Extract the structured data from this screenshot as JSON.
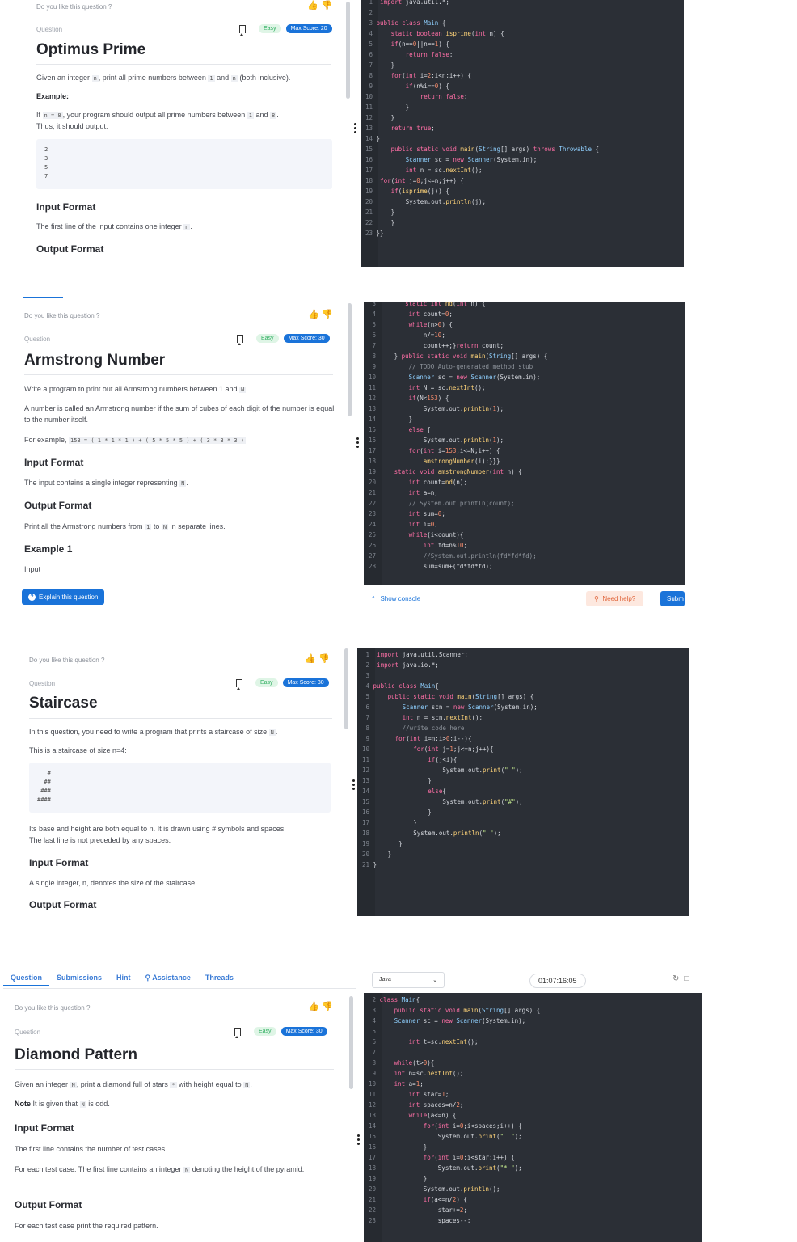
{
  "colors": {
    "brand": "#1a73d9",
    "easy_bg": "#dff5e6",
    "easy_fg": "#2fae60",
    "code_bg": "#2b2f36"
  },
  "common": {
    "like_question": "Do you like this question ?",
    "question_label": "Question",
    "easy": "Easy",
    "thumbs_up_icon": "thumbs-up-icon",
    "thumbs_down_icon": "thumbs-down-icon",
    "bookmark_icon": "bookmark-icon"
  },
  "p1": {
    "max_score": "Max Score: 20",
    "title": "Optimus Prime",
    "desc_a": "Given an integer",
    "desc_n1": "n",
    "desc_b": ", print all prime numbers between",
    "desc_1": "1",
    "desc_c": "and",
    "desc_n2": "n",
    "desc_d": "(both inclusive).",
    "example_label": "Example:",
    "if_a": "If",
    "if_code": "n = 8",
    "if_b": ", your program should output all prime numbers between",
    "if_1": "1",
    "if_c": "and",
    "if_8": "8",
    "thus": "Thus, it should output:",
    "output_block": "2\n3\n5\n7",
    "input_format": "Input Format",
    "input_text_a": "The first line of the input contains one integer",
    "input_text_n": "n",
    "output_format": "Output Format",
    "code_lines": [
      "1",
      "2",
      "3",
      "4",
      "5",
      "6",
      "7",
      "8",
      "9",
      "10",
      "11",
      "12",
      "13",
      "14",
      "15",
      "16",
      "17",
      "18",
      "19",
      "20",
      "21",
      "22",
      "23"
    ]
  },
  "p2": {
    "max_score": "Max Score: 30",
    "title": "Armstrong Number",
    "desc_a": "Write a program to print out all Armstrong numbers between 1 and",
    "desc_n": "N",
    "desc2": "A number is called an Armstrong number if the sum of cubes of each digit of the number is equal to the number itself.",
    "for_example": "For example,",
    "example_code": "153 = ( 1 * 1 * 1 ) + ( 5 * 5 * 5 ) + ( 3 * 3 * 3 )",
    "input_format": "Input Format",
    "input_text_a": "The input contains a single integer representing",
    "input_text_n": "N",
    "output_format": "Output Format",
    "output_text_a": "Print all the Armstrong numbers from",
    "output_1": "1",
    "output_to": "to",
    "output_n": "N",
    "output_text_b": "in separate lines.",
    "example1": "Example 1",
    "input_label": "Input",
    "explain": "Explain this question",
    "show_console": "Show console",
    "need_help": "Need help?",
    "submit": "Subm"
  },
  "p3": {
    "max_score": "Max Score: 30",
    "title": "Staircase",
    "desc_a": "In this question, you need to write a program that prints a staircase of size",
    "desc_n": "N",
    "desc2": "This is a staircase of size n=4:",
    "stair_block": "   #\n  ##\n ###\n####",
    "desc3": "Its base and height are both equal to n. It is drawn using # symbols and spaces.",
    "desc4": "The last line is not preceded by any spaces.",
    "input_format": "Input Format",
    "input_text": "A single integer, n, denotes the size of the staircase.",
    "output_format": "Output Format"
  },
  "p4": {
    "tabs": [
      "Question",
      "Submissions",
      "Hint",
      "Assistance",
      "Threads"
    ],
    "language": "Java",
    "timer": "01:07:16:05",
    "max_score": "Max Score: 30",
    "title": "Diamond Pattern",
    "desc_a": "Given an integer",
    "desc_n": "N",
    "desc_b": ", print a diamond full of stars",
    "desc_star": "*",
    "desc_c": "with height equal to",
    "desc_n2": "N",
    "note_label": "Note",
    "note_a": "It is given that",
    "note_n": "N",
    "note_b": "is odd.",
    "input_format": "Input Format",
    "input_text1": "The first line contains the number of test cases.",
    "input_text2a": "For each test case: The first line contains an integer",
    "input_text2n": "N",
    "input_text2b": "denoting the height of the pyramid.",
    "output_format": "Output Format",
    "output_text": "For each test case print the required pattern."
  }
}
